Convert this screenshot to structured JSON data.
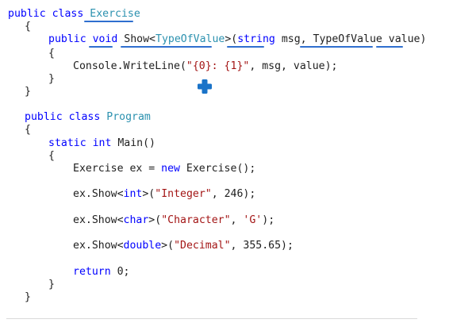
{
  "code": {
    "lines": [
      [
        {
          "c": "kw",
          "t": "public"
        },
        {
          "c": "pl",
          "t": " "
        },
        {
          "c": "kw",
          "t": "class"
        },
        {
          "c": "pl",
          "t": " "
        },
        {
          "c": "ty",
          "t": "Exercise"
        }
      ],
      [
        {
          "c": "pl",
          "t": "{"
        }
      ],
      [
        {
          "c": "kw",
          "t": "public"
        },
        {
          "c": "pl",
          "t": " "
        },
        {
          "c": "kw",
          "t": "void"
        },
        {
          "c": "pl",
          "t": " Show<"
        },
        {
          "c": "ty",
          "t": "TypeOfValue"
        },
        {
          "c": "pl",
          "t": ">("
        },
        {
          "c": "kw",
          "t": "string"
        },
        {
          "c": "pl",
          "t": " msg, TypeOfValue value)"
        }
      ],
      [
        {
          "c": "pl",
          "t": "{"
        }
      ],
      [
        {
          "c": "pl",
          "t": "Console.WriteLine("
        },
        {
          "c": "str",
          "t": "\"{0}: {1}\""
        },
        {
          "c": "pl",
          "t": ", msg, value);"
        }
      ],
      [
        {
          "c": "pl",
          "t": "}"
        }
      ],
      [
        {
          "c": "pl",
          "t": "}"
        }
      ],
      [
        {
          "c": "kw",
          "t": "public"
        },
        {
          "c": "pl",
          "t": " "
        },
        {
          "c": "kw",
          "t": "class"
        },
        {
          "c": "pl",
          "t": " "
        },
        {
          "c": "ty",
          "t": "Program"
        }
      ],
      [
        {
          "c": "pl",
          "t": "{"
        }
      ],
      [
        {
          "c": "kw",
          "t": "static"
        },
        {
          "c": "pl",
          "t": " "
        },
        {
          "c": "kw",
          "t": "int"
        },
        {
          "c": "pl",
          "t": " Main()"
        }
      ],
      [
        {
          "c": "pl",
          "t": "{"
        }
      ],
      [
        {
          "c": "pl",
          "t": "Exercise ex = "
        },
        {
          "c": "kw",
          "t": "new"
        },
        {
          "c": "pl",
          "t": " Exercise();"
        }
      ],
      [
        {
          "c": "pl",
          "t": "ex.Show<"
        },
        {
          "c": "kw",
          "t": "int"
        },
        {
          "c": "pl",
          "t": ">("
        },
        {
          "c": "str",
          "t": "\"Integer\""
        },
        {
          "c": "pl",
          "t": ", 246);"
        }
      ],
      [
        {
          "c": "pl",
          "t": "ex.Show<"
        },
        {
          "c": "kw",
          "t": "char"
        },
        {
          "c": "pl",
          "t": ">("
        },
        {
          "c": "str",
          "t": "\"Character\""
        },
        {
          "c": "pl",
          "t": ", "
        },
        {
          "c": "str",
          "t": "'G'"
        },
        {
          "c": "pl",
          "t": ");"
        }
      ],
      [
        {
          "c": "pl",
          "t": "ex.Show<"
        },
        {
          "c": "kw",
          "t": "double"
        },
        {
          "c": "pl",
          "t": ">("
        },
        {
          "c": "str",
          "t": "\"Decimal\""
        },
        {
          "c": "pl",
          "t": ", 355.65);"
        }
      ],
      [
        {
          "c": "kw",
          "t": "return"
        },
        {
          "c": "pl",
          "t": " 0;"
        }
      ],
      [
        {
          "c": "pl",
          "t": "}"
        }
      ],
      [
        {
          "c": "pl",
          "t": "}"
        }
      ]
    ]
  },
  "colors": {
    "keyword": "#0000ff",
    "type": "#2b91af",
    "string": "#a31515",
    "plain": "#1e1e1e",
    "underline": "#2f6fcf",
    "cursor": "#1a73c8"
  },
  "icons": {
    "cursor": "plus-cursor-icon"
  }
}
